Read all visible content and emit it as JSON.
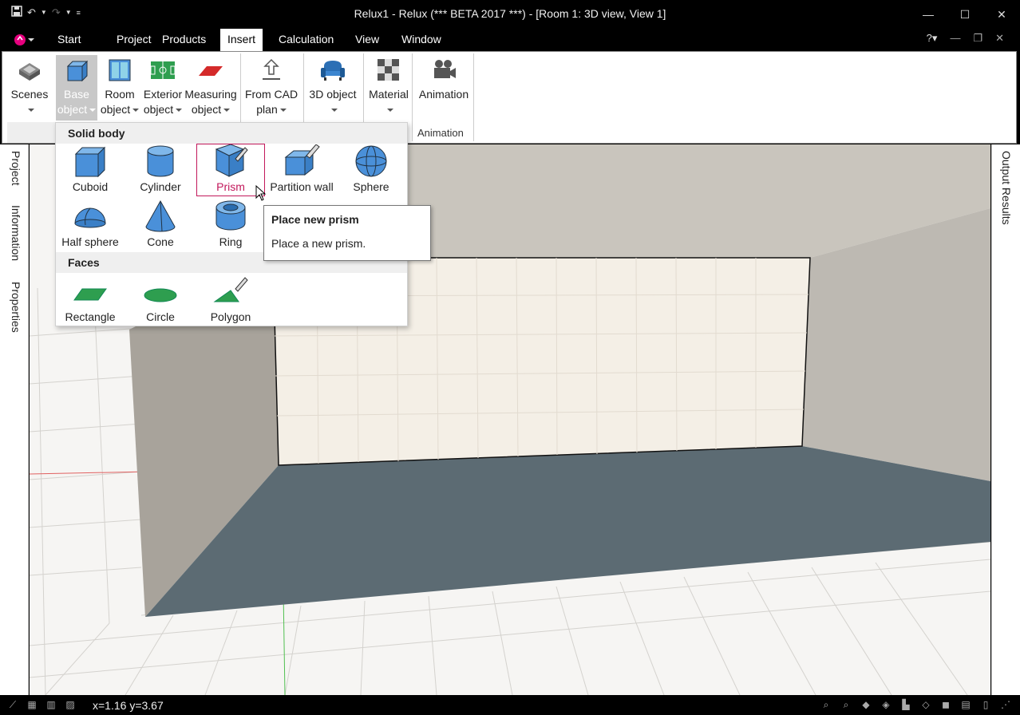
{
  "window": {
    "title": "Relux1 - Relux (*** BETA 2017 ***) - [Room 1: 3D view, View 1]"
  },
  "menu": {
    "tabs": [
      "Start",
      "Project",
      "Products",
      "Insert",
      "Calculation",
      "View",
      "Window"
    ],
    "active": "Insert"
  },
  "ribbon": {
    "scenes": "Scenes",
    "base_object_1": "Base",
    "base_object_2": "object",
    "room_object_1": "Room",
    "room_object_2": "object",
    "exterior_object_1": "Exterior",
    "exterior_object_2": "object",
    "measuring_object_1": "Measuring",
    "measuring_object_2": "object",
    "from_cad_1": "From CAD",
    "from_cad_2": "plan",
    "object_3d": "3D object",
    "material": "Material",
    "animation": "Animation",
    "animation_group": "Animation"
  },
  "side_tabs": {
    "left": [
      "Project",
      "Information",
      "Properties"
    ],
    "right": "Output Results"
  },
  "dropdown": {
    "solid_header": "Solid body",
    "faces_header": "Faces",
    "solid_items": [
      "Cuboid",
      "Cylinder",
      "Prism",
      "Partition wall",
      "Sphere",
      "Half sphere",
      "Cone",
      "Ring"
    ],
    "face_items": [
      "Rectangle",
      "Circle",
      "Polygon"
    ],
    "hovered": "Prism",
    "hover_color": "#c2185b",
    "icon_blue": "#4a90d9",
    "icon_green": "#2e9e4f"
  },
  "tooltip": {
    "title": "Place new prism",
    "body": "Place a new prism."
  },
  "status": {
    "coordinates": "x=1.16 y=3.67"
  },
  "scene_colors": {
    "floor": "#5c6b73",
    "back_wall": "#f4efe6",
    "left_wall": "#a8a39b",
    "right_wall": "#bdb9b2",
    "ceiling": "#c9c5bd",
    "grid": "#d6d4d0"
  }
}
